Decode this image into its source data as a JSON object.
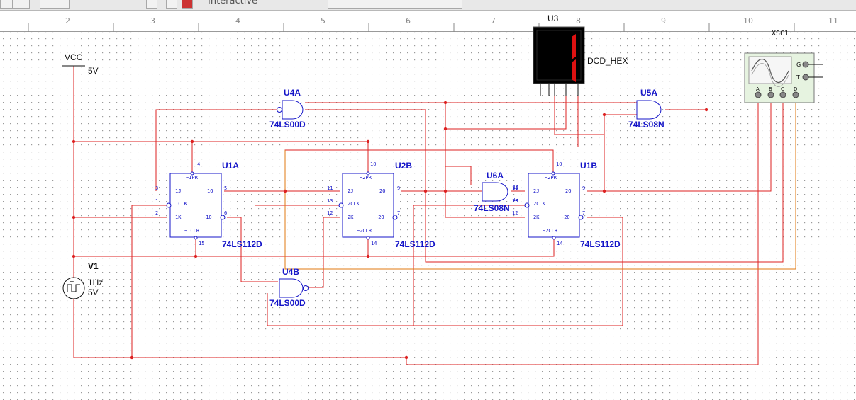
{
  "toolbar": {
    "mode_label": "Interactive",
    "buttons": [
      "play-icon",
      "pause-icon",
      "stop-icon",
      "probe-icon"
    ]
  },
  "ruler": {
    "ticks": [
      "2",
      "3",
      "4",
      "5",
      "6",
      "7",
      "8",
      "9",
      "10",
      "11"
    ]
  },
  "colors": {
    "wire": "#dd2222",
    "wire_orange": "#e07810",
    "component": "#1414c8",
    "grid_dot": "#9a9a9a",
    "display_bg": "#000000",
    "segment": "#dd1111",
    "scope_bg": "#e6f3e0"
  },
  "power": {
    "vcc_label": "VCC",
    "vcc_value": "5V"
  },
  "source": {
    "name": "V1",
    "freq": "1Hz",
    "amp": "5V"
  },
  "display": {
    "ref": "U3",
    "name": "DCD_HEX",
    "digit": "1"
  },
  "scope": {
    "ref": "XSC1",
    "pins_top": [
      "G",
      "T"
    ],
    "pins_bottom": [
      "A",
      "B",
      "C",
      "D"
    ]
  },
  "gates": [
    {
      "ref": "U4A",
      "model": "74LS00D"
    },
    {
      "ref": "U5A",
      "model": "74LS08N"
    },
    {
      "ref": "U6A",
      "model": "74LS08N"
    },
    {
      "ref": "U4B",
      "model": "74LS00D"
    }
  ],
  "flipflops": [
    {
      "ref": "U1A",
      "model": "74LS112D",
      "pr": "~1PR",
      "j": "1J",
      "clk": "1CLK",
      "k": "1K",
      "q": "1Q",
      "nq": "~1Q",
      "clr": "~1CLR",
      "pins": {
        "pr": "4",
        "j": "3",
        "clk": "1",
        "k": "2",
        "q": "5",
        "nq": "6",
        "clr": "15"
      }
    },
    {
      "ref": "U2B",
      "model": "74LS112D",
      "pr": "~2PR",
      "j": "2J",
      "clk": "2CLK",
      "k": "2K",
      "q": "2Q",
      "nq": "~2Q",
      "clr": "~2CLR",
      "pins": {
        "pr": "10",
        "j": "11",
        "clk": "13",
        "k": "12",
        "q": "9",
        "nq": "7",
        "clr": "14"
      }
    },
    {
      "ref": "U1B",
      "model": "74LS112D",
      "pr": "~2PR",
      "j": "2J",
      "clk": "2CLK",
      "k": "2K",
      "q": "2Q",
      "nq": "~2Q",
      "clr": "~2CLR",
      "pins": {
        "pr": "10",
        "j": "11",
        "clk": "13",
        "k": "12",
        "q": "9",
        "nq": "7",
        "clr": "14"
      }
    }
  ],
  "gate_pins": {
    "u6a_in1": "11",
    "u6a_in2": "13"
  }
}
